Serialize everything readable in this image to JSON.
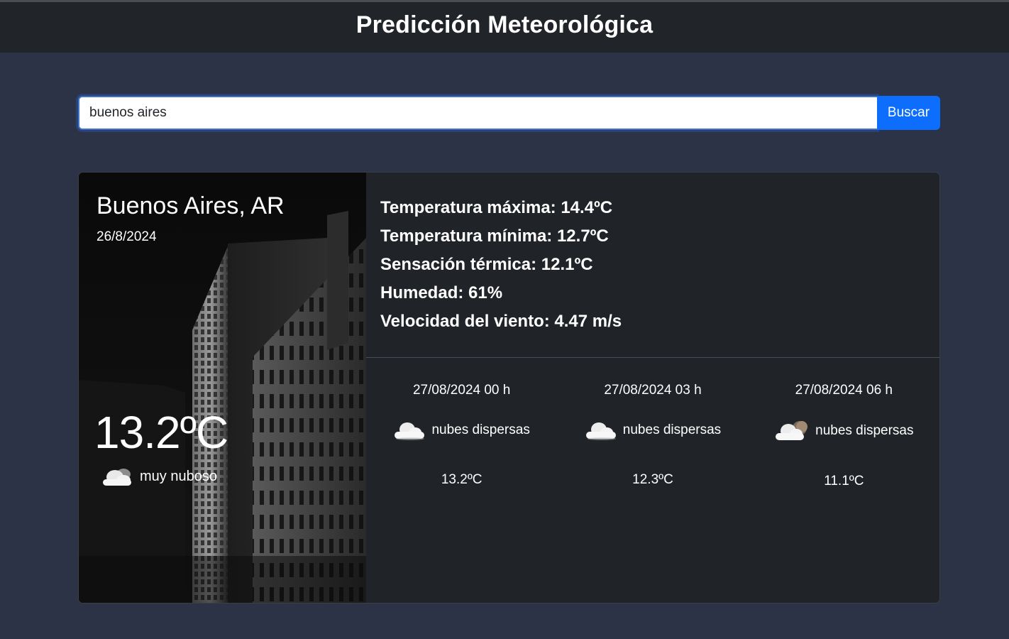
{
  "header": {
    "title": "Predicción Meteorológica"
  },
  "search": {
    "value": "buenos aires",
    "button_label": "Buscar"
  },
  "current": {
    "city": "Buenos Aires, AR",
    "date": "26/8/2024",
    "temperature": "13.2ºC",
    "condition": "muy nuboso",
    "condition_icon": "cloud-icon"
  },
  "details": {
    "max_temp": "Temperatura máxima: 14.4ºC",
    "min_temp": "Temperatura mínima: 12.7ºC",
    "feels_like": "Sensación térmica: 12.1ºC",
    "humidity": "Humedad: 61%",
    "wind": "Velocidad del viento: 4.47 m/s"
  },
  "forecast": [
    {
      "time": "27/08/2024 00 h",
      "description": "nubes dispersas",
      "temp": "13.2ºC",
      "icon": "cloud-icon"
    },
    {
      "time": "27/08/2024 03 h",
      "description": "nubes dispersas",
      "temp": "12.3ºC",
      "icon": "cloud-icon"
    },
    {
      "time": "27/08/2024 06 h",
      "description": "nubes dispersas",
      "temp": "11.1ºC",
      "icon": "cloud-moon-icon"
    }
  ],
  "colors": {
    "background": "#2d3346",
    "navbar": "#212529",
    "card": "#202328",
    "button": "#0d6efd"
  }
}
